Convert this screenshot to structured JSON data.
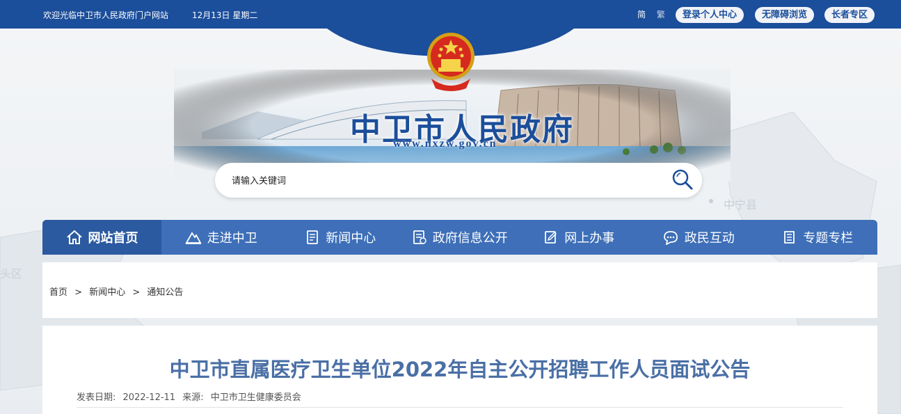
{
  "topbar": {
    "welcome": "欢迎光临中卫市人民政府门户网站",
    "date": "12月13日 星期二",
    "lang_simplified": "简",
    "lang_traditional": "繁",
    "login": "登录个人中心",
    "accessible": "无障碍浏览",
    "elder": "长者专区"
  },
  "header": {
    "title": "中卫市人民政府",
    "url": "www.nxzw.gov.cn"
  },
  "map_labels": {
    "zhongning": "中宁县",
    "toutou": "头区"
  },
  "search": {
    "placeholder": "请输入关键词"
  },
  "nav": {
    "items": [
      {
        "label": "网站首页",
        "icon": "home-icon"
      },
      {
        "label": "走进中卫",
        "icon": "mountain-icon"
      },
      {
        "label": "新闻中心",
        "icon": "news-icon"
      },
      {
        "label": "政府信息公开",
        "icon": "document-icon"
      },
      {
        "label": "网上办事",
        "icon": "edit-icon"
      },
      {
        "label": "政民互动",
        "icon": "chat-icon"
      },
      {
        "label": "专题专栏",
        "icon": "book-icon"
      }
    ]
  },
  "breadcrumb": {
    "home": "首页",
    "sep": ">",
    "level1": "新闻中心",
    "level2": "通知公告"
  },
  "article": {
    "title": "中卫市直属医疗卫生单位2022年自主公开招聘工作人员面试公告",
    "date_label": "发表日期:",
    "date": "2022-12-11",
    "source_label": "来源:",
    "source": "中卫市卫生健康委员会"
  },
  "colors": {
    "primary": "#1b4e9b",
    "nav": "#3e6fb8",
    "nav_active": "#2c5aa0",
    "title": "#4a6fa5"
  }
}
